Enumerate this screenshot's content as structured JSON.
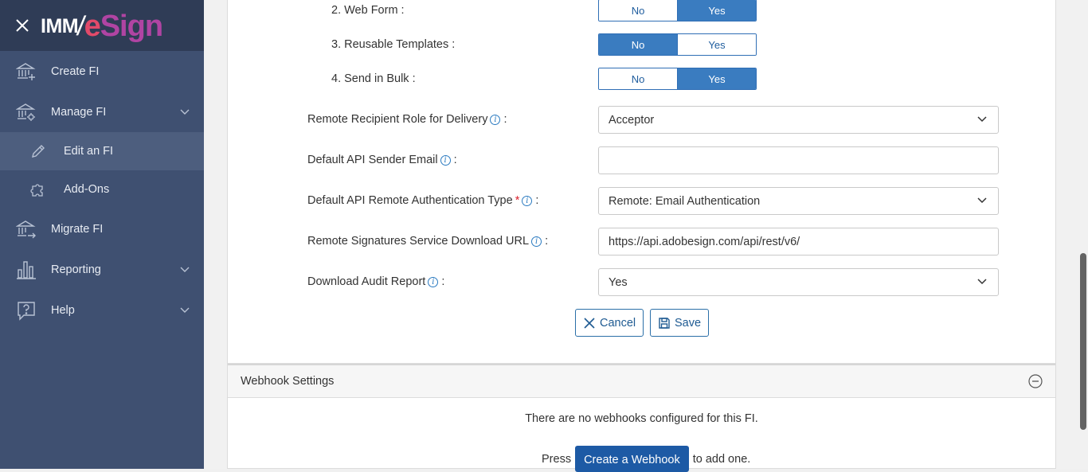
{
  "sidebar": {
    "logo_imm": "IMM",
    "logo_slash": "/",
    "logo_e": "e",
    "logo_sign": "Sign",
    "items": [
      {
        "label": "Create FI"
      },
      {
        "label": "Manage FI"
      },
      {
        "label": "Edit an FI"
      },
      {
        "label": "Add-Ons"
      },
      {
        "label": "Migrate FI"
      },
      {
        "label": "Reporting"
      },
      {
        "label": "Help"
      }
    ]
  },
  "form": {
    "toggles": [
      {
        "label": "2. Web Form :",
        "no": "No",
        "yes": "Yes",
        "selected": "Yes"
      },
      {
        "label": "3. Reusable Templates :",
        "no": "No",
        "yes": "Yes",
        "selected": "No"
      },
      {
        "label": "4. Send in Bulk :",
        "no": "No",
        "yes": "Yes",
        "selected": "Yes"
      }
    ],
    "remote_role": {
      "label": "Remote Recipient Role for Delivery",
      "value": "Acceptor"
    },
    "sender_email": {
      "label": "Default API Sender Email",
      "value": ""
    },
    "auth_type": {
      "label": "Default API Remote Authentication Type",
      "value": "Remote: Email Authentication"
    },
    "download_url": {
      "label": "Remote Signatures Service Download URL",
      "value": "https://api.adobesign.com/api/rest/v6/"
    },
    "audit_report": {
      "label": "Download Audit Report",
      "value": "Yes"
    },
    "colon": ":",
    "required_mark": "*",
    "info_glyph": "i",
    "cancel_label": "Cancel",
    "save_label": "Save"
  },
  "webhook": {
    "title": "Webhook Settings",
    "empty_msg": "There are no webhooks configured for this FI.",
    "press": "Press",
    "create_label": "Create a Webhook",
    "suffix": "to add one."
  },
  "colors": {
    "sidebar_bg": "#3f5071",
    "header_bg": "#2f3c56",
    "accent": "#3a7cc0",
    "primary_button": "#1d5aa5"
  }
}
